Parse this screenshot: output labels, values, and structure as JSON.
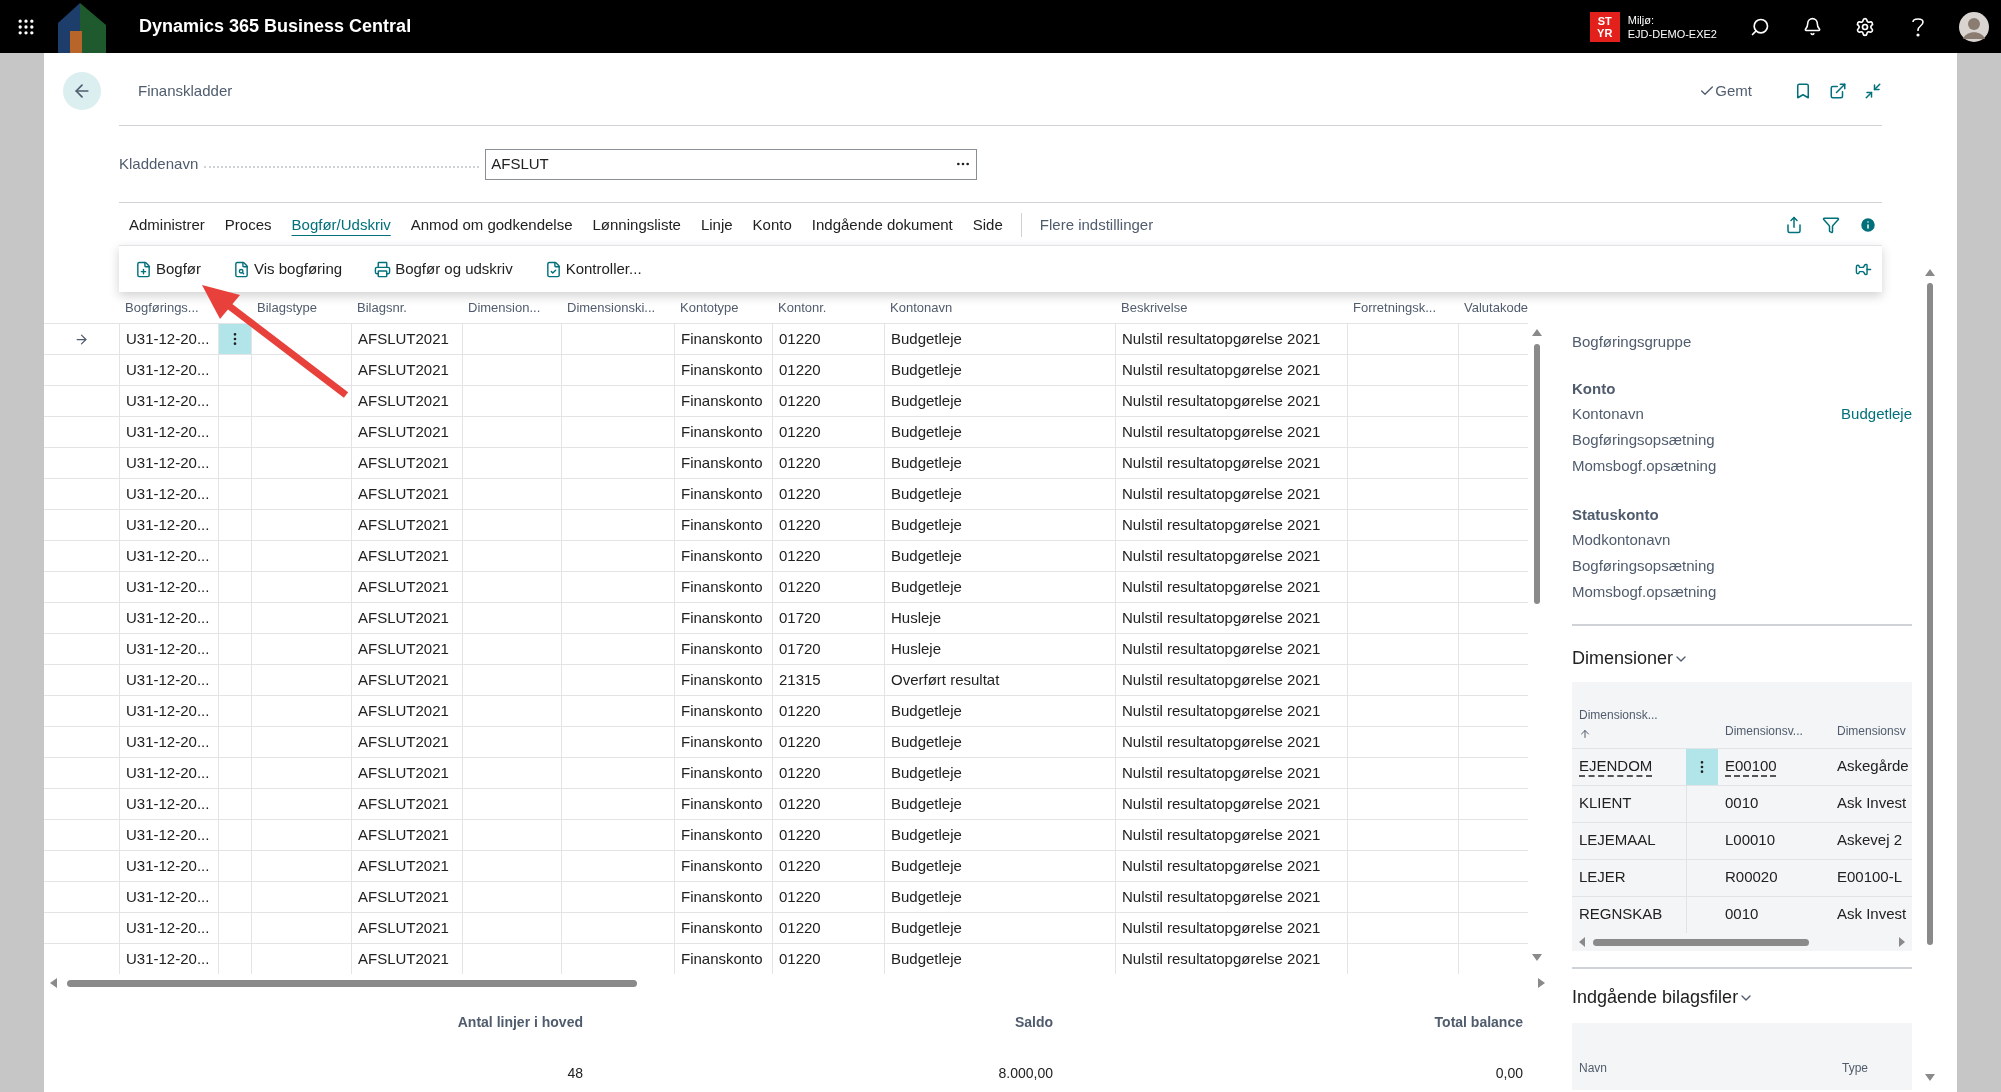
{
  "top_bar": {
    "app_title": "Dynamics 365 Business Central",
    "badge_lines": [
      "ST",
      "YR"
    ],
    "environment_label": "Miljø:",
    "environment_name": "EJD-DEMO-EXE2"
  },
  "page": {
    "title": "Finanskladder",
    "save_status": "Gemt"
  },
  "batch_field": {
    "label": "Kladdenavn",
    "value": "AFSLUT"
  },
  "action_tabs": [
    {
      "label": "Administrer",
      "selected": false
    },
    {
      "label": "Proces",
      "selected": false
    },
    {
      "label": "Bogfør/Udskriv",
      "selected": true
    },
    {
      "label": "Anmod om godkendelse",
      "selected": false
    },
    {
      "label": "Lønningsliste",
      "selected": false
    },
    {
      "label": "Linje",
      "selected": false
    },
    {
      "label": "Konto",
      "selected": false
    },
    {
      "label": "Indgående dokument",
      "selected": false
    },
    {
      "label": "Side",
      "selected": false
    }
  ],
  "more_options": "Flere indstillinger",
  "actions": [
    {
      "label": "Bogfør",
      "kind": "post"
    },
    {
      "label": "Vis bogføring",
      "kind": "preview"
    },
    {
      "label": "Bogfør og udskriv",
      "kind": "print"
    },
    {
      "label": "Kontroller...",
      "kind": "check"
    }
  ],
  "table": {
    "columns": [
      "Bogførings...",
      "Bilagstype",
      "Bilagsnr.",
      "Dimension...",
      "Dimensionski...",
      "Kontotype",
      "Kontonr.",
      "Kontonavn",
      "Beskrivelse",
      "Forretningsk...",
      "Valutakode"
    ],
    "rows": [
      {
        "selected": true,
        "posting_date": "U31-12-20...",
        "document_no": "AFSLUT2021",
        "account_type": "Finanskonto",
        "account_no": "01220",
        "account_name": "Budgetleje",
        "description": "Nulstil resultatopgørelse 2021"
      },
      {
        "selected": false,
        "posting_date": "U31-12-20...",
        "document_no": "AFSLUT2021",
        "account_type": "Finanskonto",
        "account_no": "01220",
        "account_name": "Budgetleje",
        "description": "Nulstil resultatopgørelse 2021"
      },
      {
        "selected": false,
        "posting_date": "U31-12-20...",
        "document_no": "AFSLUT2021",
        "account_type": "Finanskonto",
        "account_no": "01220",
        "account_name": "Budgetleje",
        "description": "Nulstil resultatopgørelse 2021"
      },
      {
        "selected": false,
        "posting_date": "U31-12-20...",
        "document_no": "AFSLUT2021",
        "account_type": "Finanskonto",
        "account_no": "01220",
        "account_name": "Budgetleje",
        "description": "Nulstil resultatopgørelse 2021"
      },
      {
        "selected": false,
        "posting_date": "U31-12-20...",
        "document_no": "AFSLUT2021",
        "account_type": "Finanskonto",
        "account_no": "01220",
        "account_name": "Budgetleje",
        "description": "Nulstil resultatopgørelse 2021"
      },
      {
        "selected": false,
        "posting_date": "U31-12-20...",
        "document_no": "AFSLUT2021",
        "account_type": "Finanskonto",
        "account_no": "01220",
        "account_name": "Budgetleje",
        "description": "Nulstil resultatopgørelse 2021"
      },
      {
        "selected": false,
        "posting_date": "U31-12-20...",
        "document_no": "AFSLUT2021",
        "account_type": "Finanskonto",
        "account_no": "01220",
        "account_name": "Budgetleje",
        "description": "Nulstil resultatopgørelse 2021"
      },
      {
        "selected": false,
        "posting_date": "U31-12-20...",
        "document_no": "AFSLUT2021",
        "account_type": "Finanskonto",
        "account_no": "01220",
        "account_name": "Budgetleje",
        "description": "Nulstil resultatopgørelse 2021"
      },
      {
        "selected": false,
        "posting_date": "U31-12-20...",
        "document_no": "AFSLUT2021",
        "account_type": "Finanskonto",
        "account_no": "01220",
        "account_name": "Budgetleje",
        "description": "Nulstil resultatopgørelse 2021"
      },
      {
        "selected": false,
        "posting_date": "U31-12-20...",
        "document_no": "AFSLUT2021",
        "account_type": "Finanskonto",
        "account_no": "01720",
        "account_name": "Husleje",
        "description": "Nulstil resultatopgørelse 2021"
      },
      {
        "selected": false,
        "posting_date": "U31-12-20...",
        "document_no": "AFSLUT2021",
        "account_type": "Finanskonto",
        "account_no": "01720",
        "account_name": "Husleje",
        "description": "Nulstil resultatopgørelse 2021"
      },
      {
        "selected": false,
        "posting_date": "U31-12-20...",
        "document_no": "AFSLUT2021",
        "account_type": "Finanskonto",
        "account_no": "21315",
        "account_name": "Overført resultat",
        "description": "Nulstil resultatopgørelse 2021"
      },
      {
        "selected": false,
        "posting_date": "U31-12-20...",
        "document_no": "AFSLUT2021",
        "account_type": "Finanskonto",
        "account_no": "01220",
        "account_name": "Budgetleje",
        "description": "Nulstil resultatopgørelse 2021"
      },
      {
        "selected": false,
        "posting_date": "U31-12-20...",
        "document_no": "AFSLUT2021",
        "account_type": "Finanskonto",
        "account_no": "01220",
        "account_name": "Budgetleje",
        "description": "Nulstil resultatopgørelse 2021"
      },
      {
        "selected": false,
        "posting_date": "U31-12-20...",
        "document_no": "AFSLUT2021",
        "account_type": "Finanskonto",
        "account_no": "01220",
        "account_name": "Budgetleje",
        "description": "Nulstil resultatopgørelse 2021"
      },
      {
        "selected": false,
        "posting_date": "U31-12-20...",
        "document_no": "AFSLUT2021",
        "account_type": "Finanskonto",
        "account_no": "01220",
        "account_name": "Budgetleje",
        "description": "Nulstil resultatopgørelse 2021"
      },
      {
        "selected": false,
        "posting_date": "U31-12-20...",
        "document_no": "AFSLUT2021",
        "account_type": "Finanskonto",
        "account_no": "01220",
        "account_name": "Budgetleje",
        "description": "Nulstil resultatopgørelse 2021"
      },
      {
        "selected": false,
        "posting_date": "U31-12-20...",
        "document_no": "AFSLUT2021",
        "account_type": "Finanskonto",
        "account_no": "01220",
        "account_name": "Budgetleje",
        "description": "Nulstil resultatopgørelse 2021"
      },
      {
        "selected": false,
        "posting_date": "U31-12-20...",
        "document_no": "AFSLUT2021",
        "account_type": "Finanskonto",
        "account_no": "01220",
        "account_name": "Budgetleje",
        "description": "Nulstil resultatopgørelse 2021"
      },
      {
        "selected": false,
        "posting_date": "U31-12-20...",
        "document_no": "AFSLUT2021",
        "account_type": "Finanskonto",
        "account_no": "01220",
        "account_name": "Budgetleje",
        "description": "Nulstil resultatopgørelse 2021"
      },
      {
        "selected": false,
        "posting_date": "U31-12-20...",
        "document_no": "AFSLUT2021",
        "account_type": "Finanskonto",
        "account_no": "01220",
        "account_name": "Budgetleje",
        "description": "Nulstil resultatopgørelse 2021"
      }
    ]
  },
  "totals": [
    {
      "label": "Antal linjer i hoved",
      "value": "48"
    },
    {
      "label": "Saldo",
      "value": "8.000,00"
    },
    {
      "label": "Total balance",
      "value": "0,00"
    }
  ],
  "factbox": {
    "top_field": "Bogføringsgruppe",
    "sections": [
      {
        "title": "Konto",
        "fields": [
          {
            "label": "Kontonavn",
            "value": "Budgetleje"
          },
          {
            "label": "Bogføringsopsætning"
          },
          {
            "label": "Momsbogf.opsætning"
          }
        ]
      },
      {
        "title": "Statuskonto",
        "fields": [
          {
            "label": "Modkontonavn"
          },
          {
            "label": "Bogføringsopsætning"
          },
          {
            "label": "Momsbogf.opsætning"
          }
        ]
      }
    ],
    "dimensions": {
      "title": "Dimensioner",
      "columns": [
        "Dimensionsk...",
        "Dimensionsv...",
        "Dimensionsv"
      ],
      "rows": [
        {
          "selected": true,
          "code": "EJENDOM",
          "value": "E00100",
          "name": "Askegårde"
        },
        {
          "selected": false,
          "code": "KLIENT",
          "value": "0010",
          "name": "Ask Invest"
        },
        {
          "selected": false,
          "code": "LEJEMAAL",
          "value": "L00010",
          "name": "Askevej 2"
        },
        {
          "selected": false,
          "code": "LEJER",
          "value": "R00020",
          "name": "E00100-L"
        },
        {
          "selected": false,
          "code": "REGNSKAB",
          "value": "0010",
          "name": "Ask Invest"
        }
      ]
    },
    "attachments": {
      "title": "Indgående bilagsfiler",
      "columns": [
        "Navn",
        "Type"
      ]
    }
  }
}
